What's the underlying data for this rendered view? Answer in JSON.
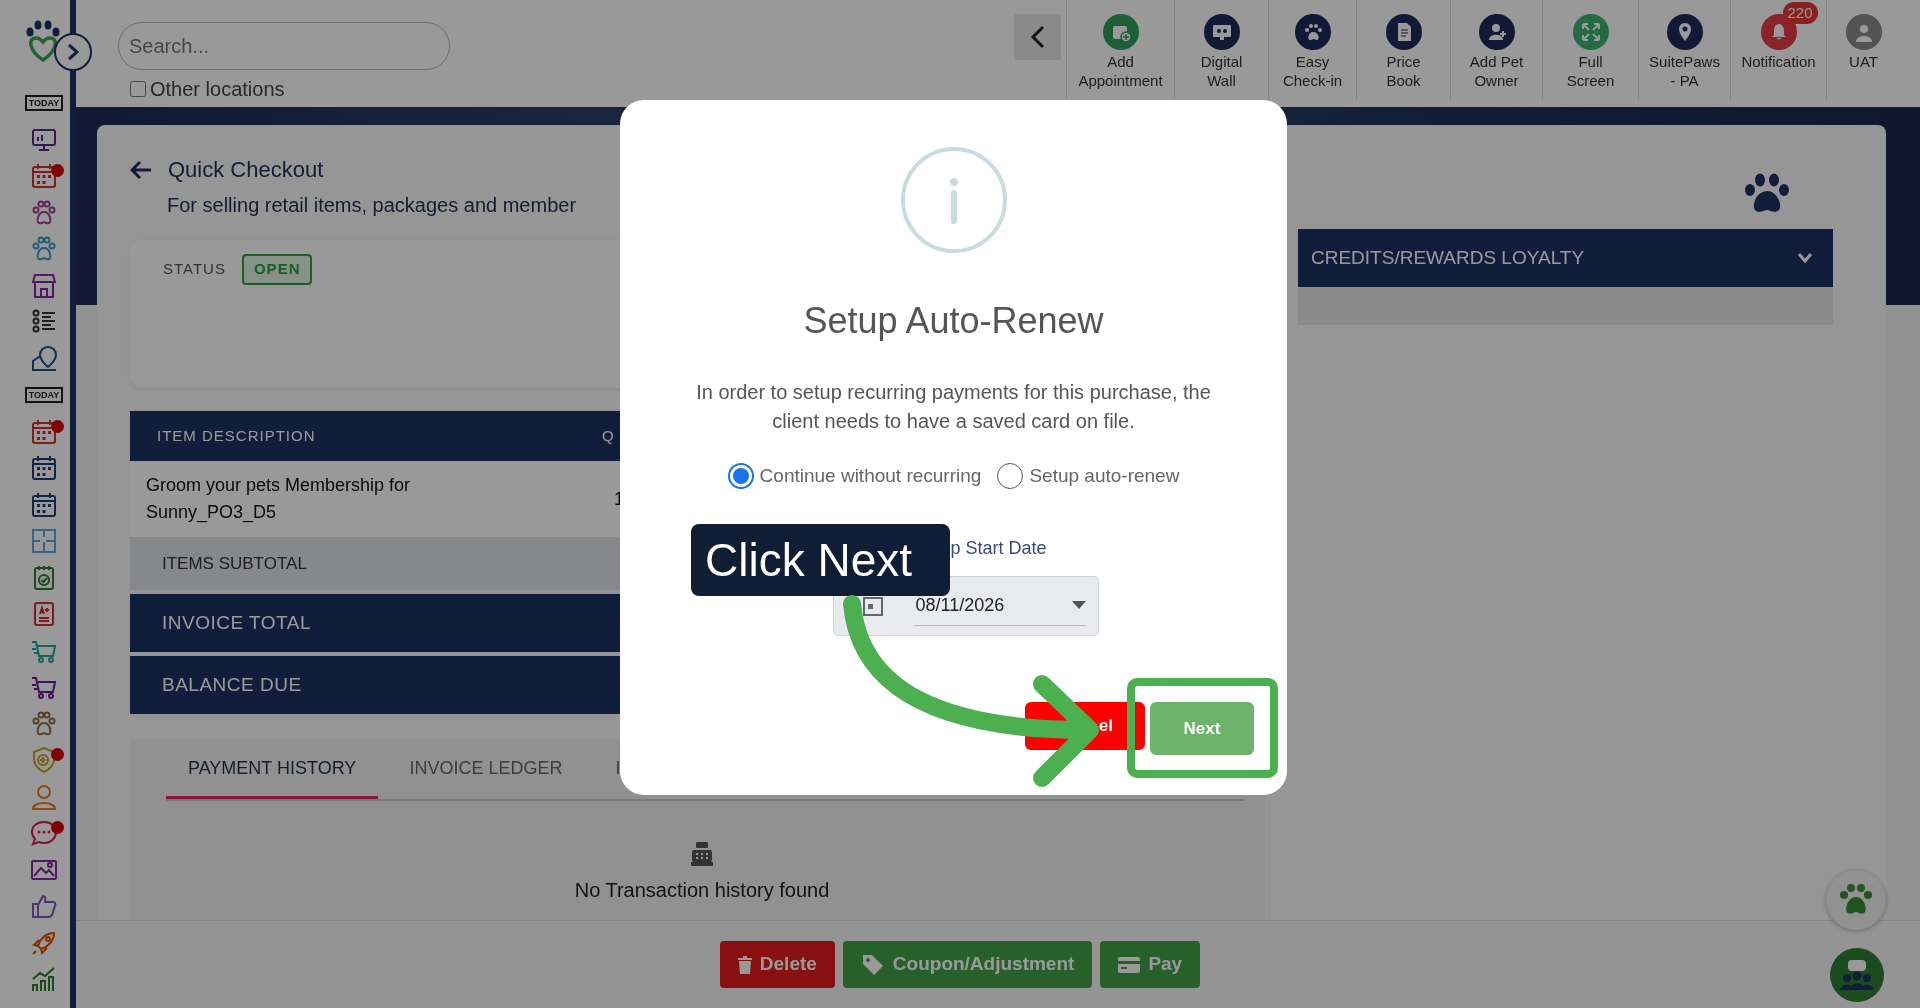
{
  "sidebar": {
    "items": [
      {
        "kind": "today",
        "label": "TODAY",
        "alert": false
      },
      {
        "kind": "monitor",
        "alert": false
      },
      {
        "kind": "calendar",
        "alert": true
      },
      {
        "kind": "paw",
        "alert": false
      },
      {
        "kind": "paw",
        "alert": false
      },
      {
        "kind": "store",
        "alert": false
      },
      {
        "kind": "list",
        "alert": false
      },
      {
        "kind": "pin",
        "alert": false
      },
      {
        "kind": "today",
        "label": "TODAY",
        "alert": false
      },
      {
        "kind": "calendar",
        "alert": true
      },
      {
        "kind": "calendar",
        "alert": false
      },
      {
        "kind": "calendar",
        "alert": false
      },
      {
        "kind": "grid",
        "alert": false
      },
      {
        "kind": "clipboard",
        "alert": false
      },
      {
        "kind": "report",
        "alert": false
      },
      {
        "kind": "cart",
        "alert": false
      },
      {
        "kind": "cart",
        "alert": false
      },
      {
        "kind": "paw",
        "alert": false
      },
      {
        "kind": "shield",
        "alert": true
      },
      {
        "kind": "person",
        "alert": false
      },
      {
        "kind": "chat",
        "alert": true
      },
      {
        "kind": "image",
        "alert": false
      },
      {
        "kind": "thumb",
        "alert": false
      },
      {
        "kind": "rocket",
        "alert": false
      },
      {
        "kind": "chart",
        "alert": false
      }
    ]
  },
  "search": {
    "placeholder": "Search..."
  },
  "other_locations": {
    "label": "Other locations",
    "checked": false
  },
  "toolbar": [
    {
      "kind": "calendar-plus",
      "label": "Add Appointment"
    },
    {
      "kind": "monitor",
      "label": "Digital Wall"
    },
    {
      "kind": "paw",
      "label": "Easy Check-in"
    },
    {
      "kind": "document",
      "label": "Price Book"
    },
    {
      "kind": "person-plus",
      "label": "Add Pet Owner"
    },
    {
      "kind": "expand",
      "label": "Full Screen"
    },
    {
      "kind": "pin",
      "label": "SuitePaws - PA"
    },
    {
      "kind": "bell",
      "label": "Notification",
      "badge": "220"
    },
    {
      "kind": "avatar",
      "label": "UAT"
    }
  ],
  "page": {
    "title": "Quick Checkout",
    "subtitle": "For selling retail items, packages and member",
    "status_label": "STATUS",
    "status": "OPEN"
  },
  "table": {
    "columns": [
      "ITEM DESCRIPTION",
      "Q"
    ],
    "rows": [
      [
        "Groom your pets Membership for Sunny_PO3_D5",
        "1"
      ]
    ],
    "subtotal_label": "ITEMS SUBTOTAL",
    "totals": [
      "INVOICE TOTAL",
      "BALANCE DUE"
    ]
  },
  "tabs": [
    {
      "label": "PAYMENT HISTORY",
      "selected": true
    },
    {
      "label": "INVOICE LEDGER",
      "selected": false
    },
    {
      "label": "I",
      "selected": false
    }
  ],
  "empty_message": "No Transaction history found",
  "credits_panel": {
    "title": "CREDITS/REWARDS LOYALTY",
    "expanded": false
  },
  "footer_buttons": [
    {
      "kind": "delete",
      "label": "Delete"
    },
    {
      "kind": "coupon",
      "label": "Coupon/Adjustment"
    },
    {
      "kind": "pay",
      "label": "Pay"
    }
  ],
  "modal": {
    "title": "Setup Auto-Renew",
    "message": "In order to setup recurring payments for this purchase, the client needs to have a saved card on file.",
    "options": [
      {
        "label": "Continue without recurring",
        "selected": true
      },
      {
        "label": "Setup auto-renew",
        "selected": false
      }
    ],
    "date_label": "p Start Date",
    "date_value": "08/11/2026",
    "buttons": [
      {
        "kind": "cancel",
        "label": "el"
      },
      {
        "kind": "next",
        "label": "Next"
      }
    ]
  },
  "callout": {
    "text": "Click Next"
  }
}
